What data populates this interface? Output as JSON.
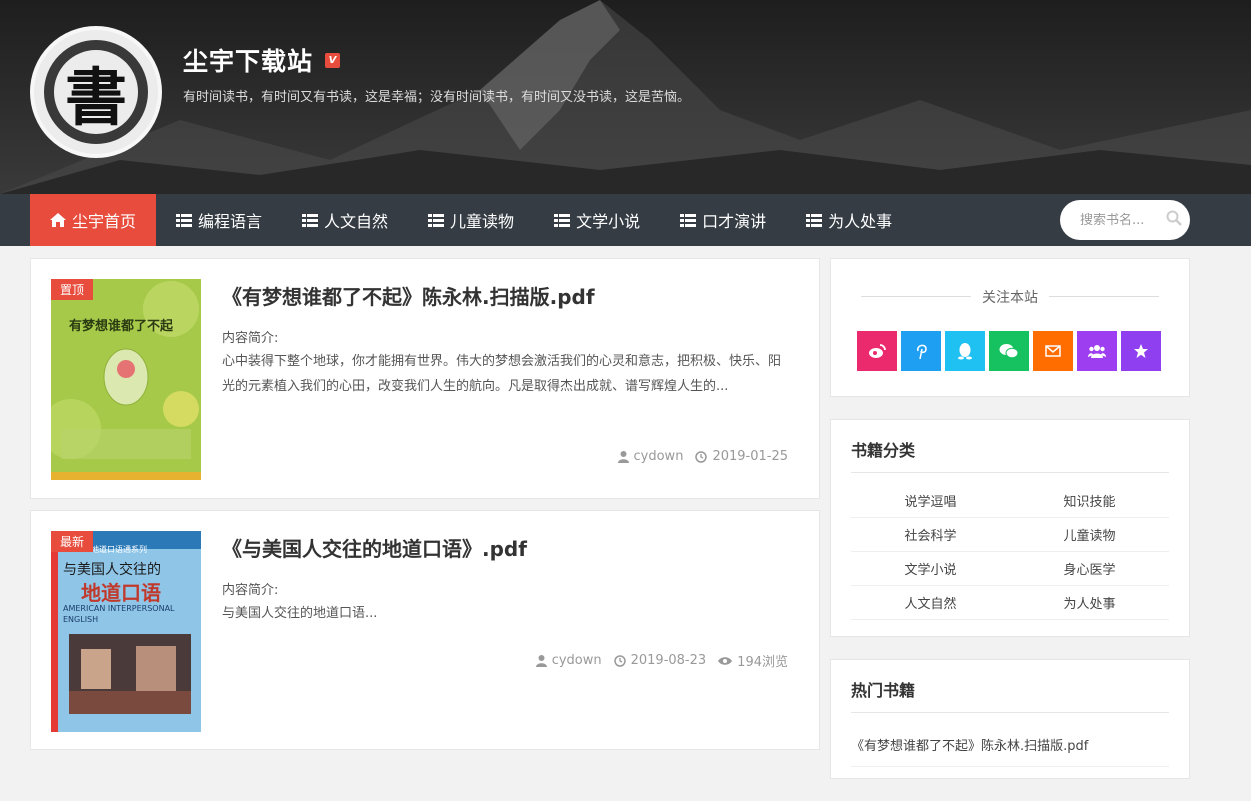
{
  "site": {
    "logo_char": "書",
    "title": "尘宇下载站",
    "badge": "V",
    "description": "有时间读书，有时间又有书读，这是幸福；没有时间读书，有时间又没书读，这是苦恼。"
  },
  "nav": {
    "items": [
      {
        "label": "尘宇首页",
        "icon": "home-icon",
        "active": true
      },
      {
        "label": "编程语言",
        "icon": "list-icon"
      },
      {
        "label": "人文自然",
        "icon": "list-icon"
      },
      {
        "label": "儿童读物",
        "icon": "list-icon"
      },
      {
        "label": "文学小说",
        "icon": "list-icon"
      },
      {
        "label": "口才演讲",
        "icon": "list-icon"
      },
      {
        "label": "为人处事",
        "icon": "list-icon"
      }
    ],
    "search_placeholder": "搜索书名..."
  },
  "posts": [
    {
      "tag": "置顶",
      "title": "《有梦想谁都了不起》陈永林.扫描版.pdf",
      "subheading": "内容简介:",
      "excerpt": "心中装得下整个地球，你才能拥有世界。伟大的梦想会激活我们的心灵和意志，把积极、快乐、阳光的元素植入我们的心田，改变我们人生的航向。凡是取得杰出成就、谱写辉煌人生的...",
      "author": "cydown",
      "date": "2019-01-25",
      "cover_title": "有梦想谁都了不起"
    },
    {
      "tag": "最新",
      "title": "《与美国人交往的地道口语》.pdf",
      "subheading": "内容简介:",
      "excerpt": "与美国人交往的地道口语...",
      "author": "cydown",
      "date": "2019-08-23",
      "views": "194浏览",
      "cover_series": "地道口语通系列",
      "cover_line1": "与美国人交往的",
      "cover_line2": "地道口语",
      "cover_en": "AMERICAN INTERPERSONAL ENGLISH"
    }
  ],
  "sidebar": {
    "follow_title": "关注本站",
    "social": [
      {
        "icon": "weibo-icon",
        "color": "#ea2a6c"
      },
      {
        "icon": "pinterest-icon",
        "color": "#1e9ff2"
      },
      {
        "icon": "qq-icon",
        "color": "#1ec1f1"
      },
      {
        "icon": "wechat-icon",
        "color": "#16c25f"
      },
      {
        "icon": "mail-icon",
        "color": "#ff6d00"
      },
      {
        "icon": "group-icon",
        "color": "#9d3ef0"
      },
      {
        "icon": "star-icon",
        "color": "#8f3ff0"
      }
    ],
    "categories_title": "书籍分类",
    "categories": [
      "说学逗唱",
      "知识技能",
      "社会科学",
      "儿童读物",
      "文学小说",
      "身心医学",
      "人文自然",
      "为人处事"
    ],
    "hot_title": "热门书籍",
    "hot": [
      "《有梦想谁都了不起》陈永林.扫描版.pdf"
    ]
  },
  "colors": {
    "accent": "#e74c3c",
    "nav_bg": "#353c44"
  }
}
